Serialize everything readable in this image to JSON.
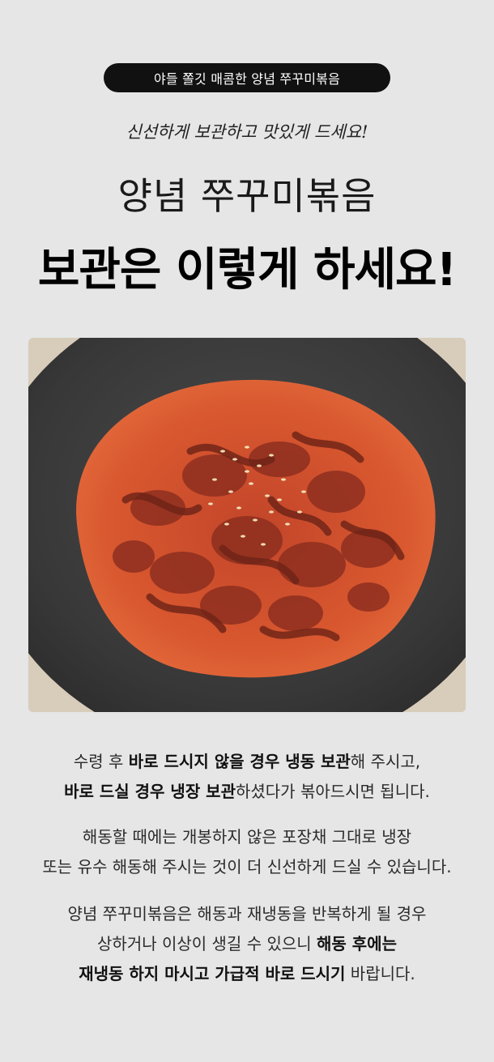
{
  "header": {
    "pill_text": "야들 쫄깃 매콤한 양념 쭈꾸미볶음",
    "script_text": "신선하게 보관하고 맛있게 드세요!",
    "title_line1": "양념 쭈꾸미볶음",
    "title_line2": "보관은 이렇게 하세요!"
  },
  "colors": {
    "background": "#e6e6e6",
    "pill": "#111111",
    "plate": "#3a3a3a",
    "sauce": "#d8502e"
  },
  "photo": {
    "icon": "stir-fried-octopus-dish-photo"
  },
  "paragraphs": {
    "p1": {
      "l1_a": "수령 후 ",
      "l1_b": "바로 드시지 않을 경우 냉동 보관",
      "l1_c": "해 주시고,",
      "l2_b": "바로 드실 경우 냉장 보관",
      "l2_c": "하셨다가 볶아드시면 됩니다."
    },
    "p2": {
      "l1": "해동할 때에는 개봉하지 않은 포장채 그대로 냉장",
      "l2": "또는 유수 해동해 주시는 것이 더 신선하게 드실 수 있습니다."
    },
    "p3": {
      "l1": "양념 쭈꾸미볶음은 해동과 재냉동을 반복하게 될 경우",
      "l2_a": "상하거나 이상이 생길 수 있으니 ",
      "l2_b": "해동 후에는",
      "l3_b": "재냉동 하지 마시고 가급적 바로 드시기",
      "l3_c": " 바랍니다."
    }
  }
}
